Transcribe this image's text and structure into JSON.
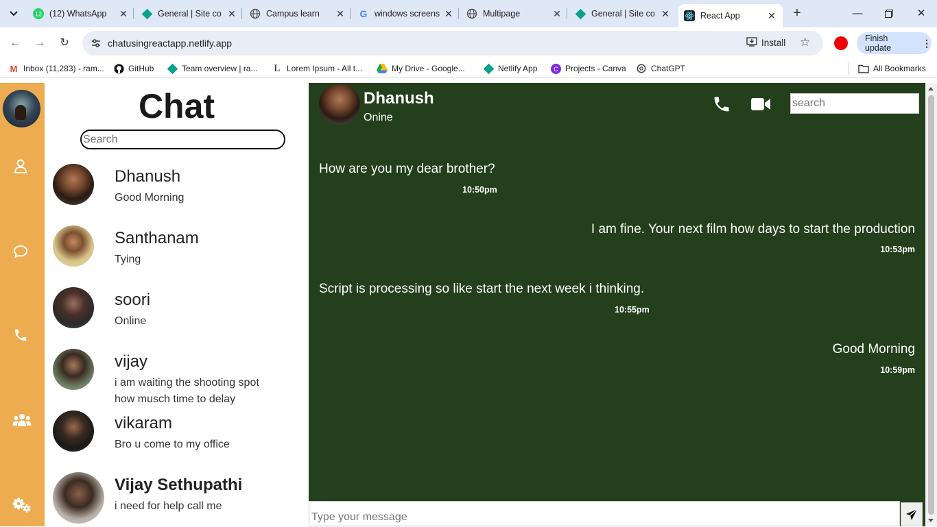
{
  "browser": {
    "tabs": [
      {
        "title": "(12) WhatsApp",
        "icon": "whatsapp-icon",
        "badge": "12"
      },
      {
        "title": "General | Site co",
        "icon": "site-diamond-icon"
      },
      {
        "title": "Campus learn",
        "icon": "globe-icon"
      },
      {
        "title": "windows screens",
        "icon": "google-icon"
      },
      {
        "title": "Multipage",
        "icon": "globe-icon"
      },
      {
        "title": "General | Site co",
        "icon": "site-diamond-icon"
      },
      {
        "title": "React App",
        "icon": "react-icon",
        "active": true
      }
    ],
    "url": "chatusingreactapp.netlify.app",
    "install_label": "Install",
    "finish_update_label": "Finish update",
    "bookmarks": [
      {
        "label": "Inbox (11,283) - ram...",
        "icon": "gmail-icon"
      },
      {
        "label": "GitHub",
        "icon": "github-icon"
      },
      {
        "label": "Team overview | ra...",
        "icon": "site-diamond-icon"
      },
      {
        "label": "Lorem Ipsum - All t...",
        "icon": "lorem-icon"
      },
      {
        "label": "My Drive - Google...",
        "icon": "drive-icon"
      },
      {
        "label": "Netlify App",
        "icon": "site-diamond-icon"
      },
      {
        "label": "Projects - Canva",
        "icon": "canva-icon"
      },
      {
        "label": "ChatGPT",
        "icon": "chatgpt-icon"
      }
    ],
    "all_bookmarks_label": "All Bookmarks"
  },
  "sidebar": {
    "icons": [
      "user-icon",
      "chat-bubble-icon",
      "phone-icon",
      "group-icon",
      "settings-icon"
    ],
    "accent": "#ecac4f"
  },
  "contacts": {
    "title": "Chat",
    "search_placeholder": "Search",
    "items": [
      {
        "name": "Dhanush",
        "message": "Good Morning"
      },
      {
        "name": "Santhanam",
        "message": "Tying"
      },
      {
        "name": "soori",
        "message": "Online"
      },
      {
        "name": "vijay",
        "message": "i am waiting the shooting spot how musch time to delay"
      },
      {
        "name": "vikaram",
        "message": "Bro u come to my office"
      },
      {
        "name": "Vijay Sethupathi",
        "message": "i need for help call me"
      }
    ]
  },
  "chat": {
    "background": "#233f1c",
    "peer_name": "Dhanush",
    "peer_status": "Onine",
    "search_placeholder": "search",
    "messages": [
      {
        "text": "How are you my dear brother?",
        "time": "10:50pm",
        "side": "left"
      },
      {
        "text": "I am fine. Your next film how days to start the production",
        "time": "10:53pm",
        "side": "right"
      },
      {
        "text": "Script is processing so like start the next week i thinking.",
        "time": "10:55pm",
        "side": "left"
      },
      {
        "text": "Good Morning",
        "time": "10:59pm",
        "side": "right"
      }
    ],
    "compose_placeholder": "Type your message"
  }
}
